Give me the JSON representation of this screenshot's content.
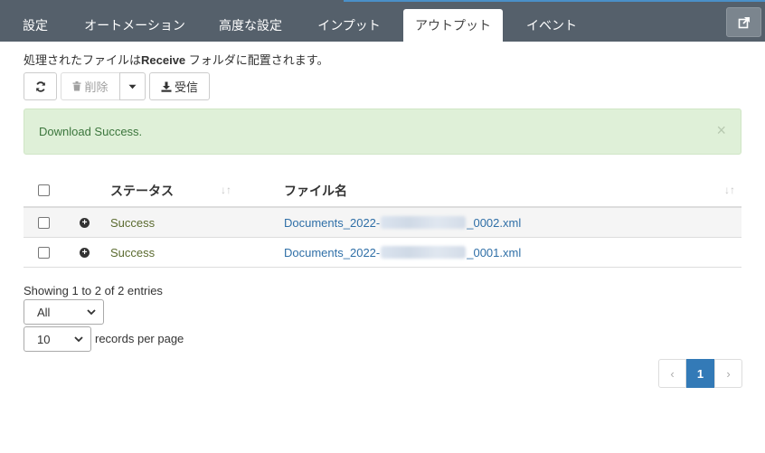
{
  "tabs": [
    {
      "label": "設定",
      "active": false
    },
    {
      "label": "オートメーション",
      "active": false
    },
    {
      "label": "高度な設定",
      "active": false
    },
    {
      "label": "インプット",
      "active": false
    },
    {
      "label": "アウトプット",
      "active": true
    },
    {
      "label": "イベント",
      "active": false
    }
  ],
  "header": {
    "external_link_icon": "external-link-icon"
  },
  "info": {
    "prefix": "処理されたファイルは",
    "folder": "Receive",
    "suffix": " フォルダに配置されます。"
  },
  "toolbar": {
    "refresh_icon": "refresh-icon",
    "delete_label": "削除",
    "delete_icon": "trash-icon",
    "dropdown_icon": "caret-down-icon",
    "receive_label": "受信",
    "receive_icon": "download-icon"
  },
  "alert": {
    "message": "Download Success.",
    "close": "×",
    "color": "#dff0d8"
  },
  "table": {
    "columns": [
      "ステータス",
      "ファイル名"
    ],
    "rows": [
      {
        "status": "Success",
        "file_prefix": "Documents_2022-",
        "file_suffix": "_0002.xml"
      },
      {
        "status": "Success",
        "file_prefix": "Documents_2022-",
        "file_suffix": "_0001.xml"
      }
    ]
  },
  "footer": {
    "showing": "Showing 1 to 2 of 2 entries",
    "filter_value": "All",
    "page_size_value": "10",
    "records_per_page": "records per page"
  },
  "pagination": {
    "prev": "‹",
    "current": "1",
    "next": "›",
    "accent": "#337ab7"
  }
}
